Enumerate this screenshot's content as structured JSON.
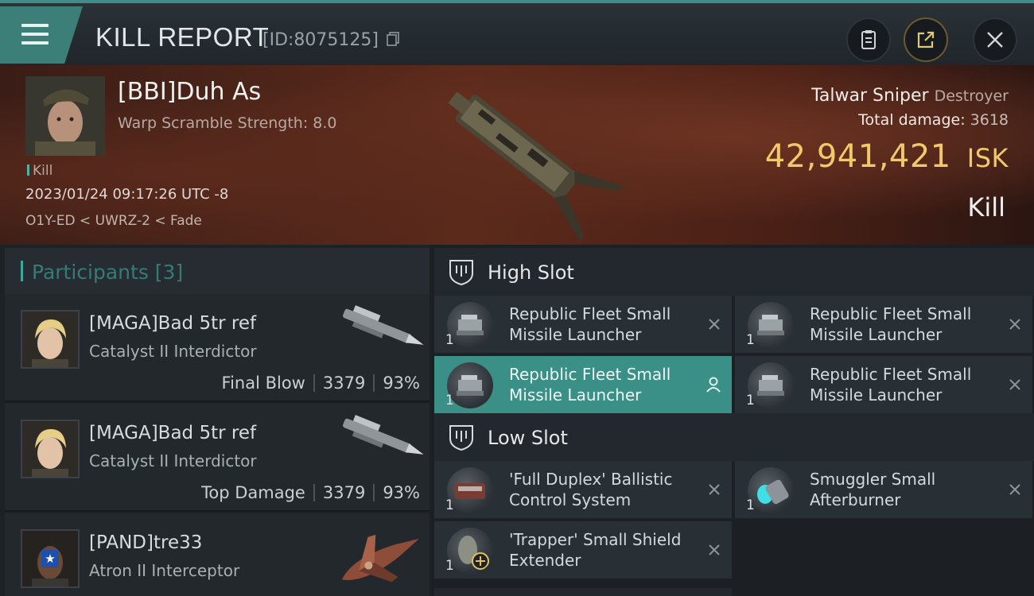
{
  "header": {
    "title": "KILL REPORT",
    "report_id": "[ID:8075125]"
  },
  "victim": {
    "name": "[BBI]Duh As",
    "warp_scramble": "Warp Scramble Strength: 8.0",
    "tag": "Kill",
    "datetime": "2023/01/24 09:17:26 UTC -8",
    "location": "O1Y-ED < UWRZ-2 < Fade",
    "ship_name": "Talwar Sniper",
    "ship_class": "Destroyer",
    "total_damage_label": "Total damage:",
    "total_damage": "3618",
    "isk_value": "42,941,421",
    "isk_unit": "ISK",
    "result": "Kill"
  },
  "participants": {
    "header": "Participants [3]",
    "items": [
      {
        "name": "[MAGA]Bad 5tr ref",
        "ship": "Catalyst II Interdictor",
        "role": "Final Blow",
        "damage": "3379",
        "percent": "93%"
      },
      {
        "name": "[MAGA]Bad 5tr ref",
        "ship": "Catalyst II Interdictor",
        "role": "Top Damage",
        "damage": "3379",
        "percent": "93%"
      },
      {
        "name": "[PAND]tre33",
        "ship": "Atron II Interceptor"
      }
    ]
  },
  "slots": {
    "high": {
      "label": "High Slot",
      "modules": [
        {
          "name": "Republic Fleet Small Missile Launcher",
          "qty": "1"
        },
        {
          "name": "Republic Fleet Small Missile Launcher",
          "qty": "1"
        },
        {
          "name": "Republic Fleet Small Missile Launcher",
          "qty": "1"
        },
        {
          "name": "Republic Fleet Small Missile Launcher",
          "qty": "1"
        }
      ]
    },
    "low": {
      "label": "Low Slot",
      "modules": [
        {
          "name": "'Full Duplex' Ballistic Control System",
          "qty": "1"
        },
        {
          "name": "Smuggler Small Afterburner",
          "qty": "1"
        },
        {
          "name": "'Trapper' Small Shield Extender",
          "qty": "1"
        }
      ]
    }
  },
  "colors": {
    "accent_teal": "#3b7f78",
    "isk_gold": "#f2c96a",
    "active_row": "#3a8f86"
  }
}
